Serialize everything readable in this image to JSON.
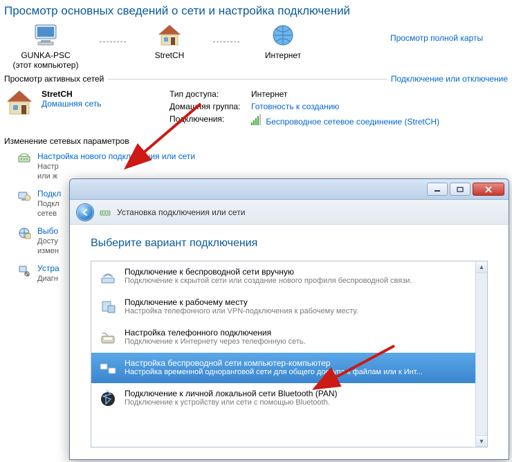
{
  "heading": "Просмотр основных сведений о сети и настройка подключений",
  "map": {
    "this_pc_name": "GUNKA-PSC",
    "this_pc_sub": "(этот компьютер)",
    "router_name": "StretCH",
    "internet_label": "Интернет",
    "full_map_link": "Просмотр полной карты"
  },
  "active_networks": {
    "section_label": "Просмотр активных сетей",
    "right_link": "Подключение или отключение",
    "network_name": "StretCH",
    "network_type_link": "Домашняя сеть",
    "rows": {
      "access_label": "Тип доступа:",
      "access_value": "Интернет",
      "homegroup_label": "Домашняя группа:",
      "homegroup_link": "Готовность к созданию",
      "conn_label": "Подключения:",
      "conn_link": "Беспроводное сетевое соединение (StretCH)"
    }
  },
  "change_settings": {
    "title": "Изменение сетевых параметров",
    "tasks": [
      {
        "title": "Настройка нового подключения или сети",
        "desc_line1": "Настр",
        "desc_line2": "или ж"
      },
      {
        "title": "Подкл",
        "desc_line1": "Подкл",
        "desc_line2": "сетев"
      },
      {
        "title": "Выбо",
        "desc_line1": "Досту",
        "desc_line2": "измен"
      },
      {
        "title": "Устра",
        "desc_line1": "Диагн",
        "desc_line2": ""
      }
    ]
  },
  "wizard": {
    "header": "Установка подключения или сети",
    "title": "Выберите вариант подключения",
    "options": [
      {
        "title": "Подключение к беспроводной сети вручную",
        "desc": "Подключение к скрытой сети или создание нового профиля беспроводной связи."
      },
      {
        "title": "Подключение к рабочему месту",
        "desc": "Настройка телефонного или VPN-подключения к рабочему месту."
      },
      {
        "title": "Настройка телефонного подключения",
        "desc": "Подключение к Интернету через телефонную сеть."
      },
      {
        "title": "Настройка беспроводной сети компьютер-компьютер",
        "desc": "Настройка временной одноранговой сети для общего доступа к файлам или к Инт...",
        "selected": true
      },
      {
        "title": "Подключение к личной локальной сети Bluetooth (PAN)",
        "desc": "Подключение к устройству или сети с помощью Bluetooth."
      }
    ]
  }
}
